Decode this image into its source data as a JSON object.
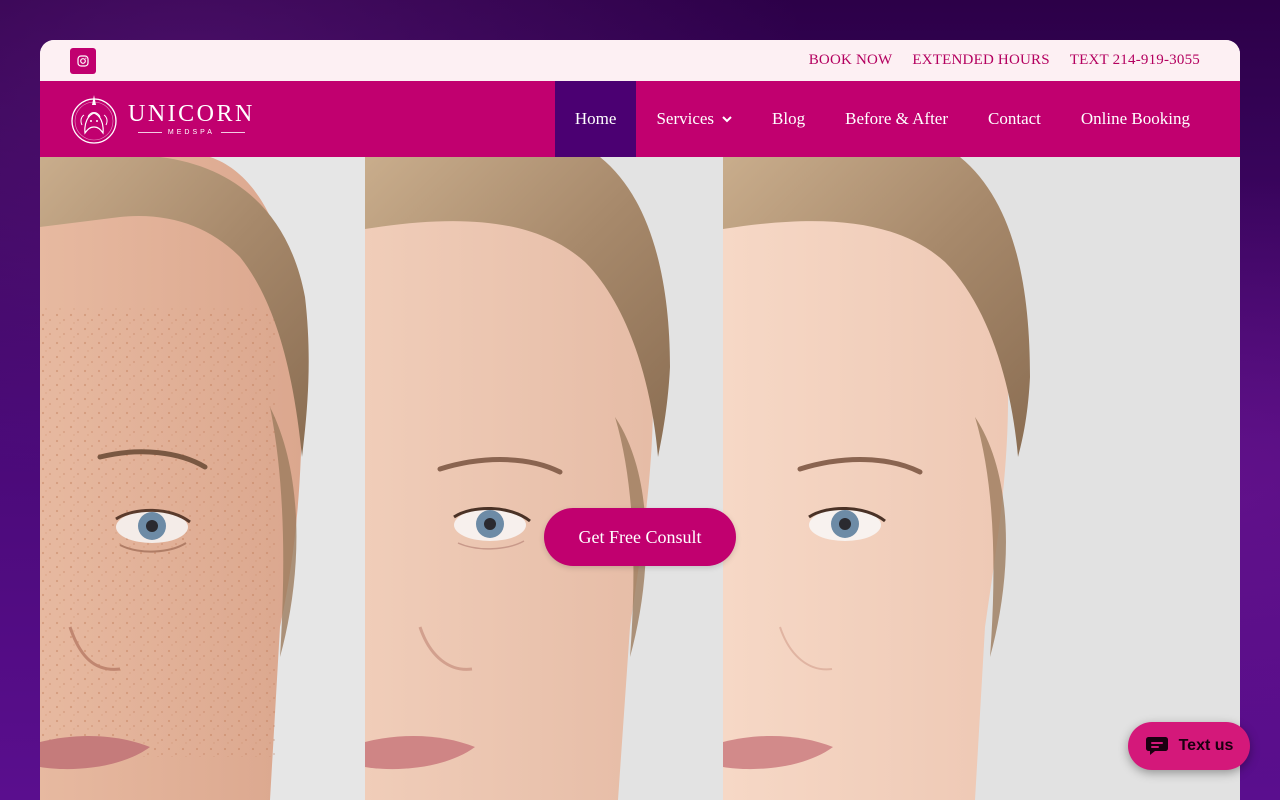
{
  "topbar": {
    "social_icon": "instagram-icon",
    "links": [
      "BOOK NOW",
      "EXTENDED HOURS",
      "TEXT 214-919-3055"
    ]
  },
  "nav": {
    "logo": {
      "name": "UNICORN",
      "tagline": "MEDSPA"
    },
    "items": [
      {
        "label": "Home",
        "active": true
      },
      {
        "label": "Services",
        "has_dropdown": true
      },
      {
        "label": "Blog"
      },
      {
        "label": "Before & After"
      },
      {
        "label": "Contact"
      },
      {
        "label": "Online Booking"
      }
    ]
  },
  "hero": {
    "image": "before-after-face-comparison",
    "cta_label": "Get Free Consult"
  },
  "chat_widget": {
    "label": "Text us",
    "icon": "chat-bubble-icon"
  },
  "colors": {
    "brand": "#c1006f",
    "active_nav": "#4b0072",
    "topbar_bg": "#fdf0f3",
    "page_bg": "#3a0060"
  }
}
